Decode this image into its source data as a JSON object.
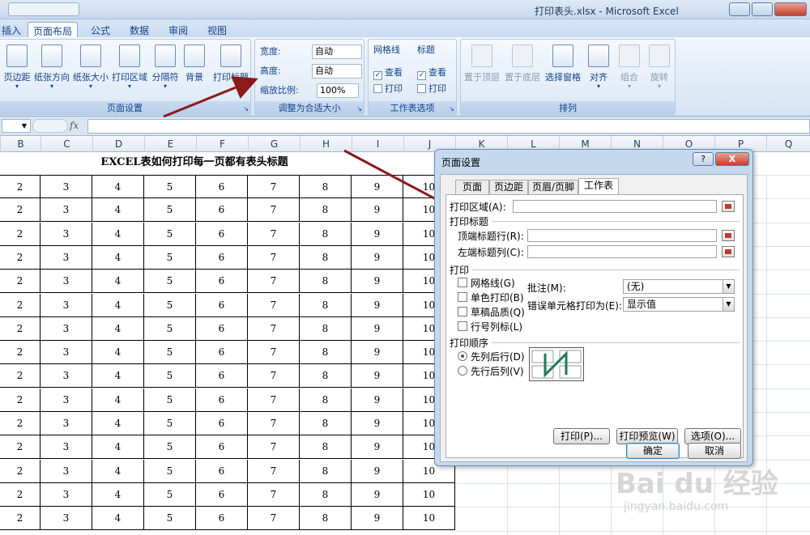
{
  "window": {
    "title": "打印表头.xlsx - Microsoft Excel"
  },
  "tabs": [
    "插入",
    "页面布局",
    "公式",
    "数据",
    "审阅",
    "视图"
  ],
  "ribbon": {
    "page_setup": {
      "buttons": [
        "页边距",
        "纸张方向",
        "纸张大小",
        "打印区域",
        "分隔符",
        "背景",
        "打印标题"
      ],
      "group_label": "页面设置"
    },
    "scale": {
      "width_label": "宽度:",
      "width_value": "自动",
      "height_label": "高度:",
      "height_value": "自动",
      "scale_label": "缩放比例:",
      "scale_value": "100%",
      "group_label": "调整为合适大小"
    },
    "sheet_options": {
      "gridlines_label": "网格线",
      "headings_label": "标题",
      "view_label": "查看",
      "print_label": "打印",
      "gridlines_view_checked": true,
      "gridlines_print_checked": false,
      "headings_view_checked": true,
      "headings_print_checked": false,
      "group_label": "工作表选项"
    },
    "arrange": {
      "buttons": [
        "置于顶层",
        "置于底层",
        "选择窗格",
        "对齐",
        "组合",
        "旋转"
      ],
      "group_label": "排列"
    }
  },
  "formula_bar": {
    "fx": "fx"
  },
  "columns": [
    "B",
    "C",
    "D",
    "E",
    "F",
    "G",
    "H",
    "I",
    "J",
    "K",
    "L",
    "M",
    "N",
    "O",
    "P",
    "Q"
  ],
  "sheet": {
    "title": "EXCEL表如何打印每一页都有表头标题",
    "row_values": [
      "2",
      "3",
      "4",
      "5",
      "6",
      "7",
      "8",
      "9",
      "10"
    ],
    "row_count": 15
  },
  "dialog": {
    "title": "页面设置",
    "help": "?",
    "close": "X",
    "tabs": [
      "页面",
      "页边距",
      "页眉/页脚",
      "工作表"
    ],
    "print_area_label": "打印区域(A):",
    "print_titles_section": "打印标题",
    "rows_repeat_label": "顶端标题行(R):",
    "cols_repeat_label": "左端标题列(C):",
    "print_section": "打印",
    "options": [
      "网格线(G)",
      "单色打印(B)",
      "草稿品质(Q)",
      "行号列标(L)"
    ],
    "comments_label": "批注(M):",
    "comments_value": "(无)",
    "errors_label": "错误单元格打印为(E):",
    "errors_value": "显示值",
    "order_section": "打印顺序",
    "order_options": [
      "先列后行(D)",
      "先行后列(V)"
    ],
    "order_selected": 0,
    "print_button": "打印(P)...",
    "preview_button": "打印预览(W)",
    "options_button": "选项(O)...",
    "ok": "确定",
    "cancel": "取消"
  },
  "watermark": {
    "main": "Bai du 经验",
    "sub": "jingyan.baidu.com"
  },
  "colors": {
    "ribbon": "#dbe7f5",
    "dialog_frame": "#c5d8ee",
    "annotation_arrow": "#8b1a1a"
  }
}
